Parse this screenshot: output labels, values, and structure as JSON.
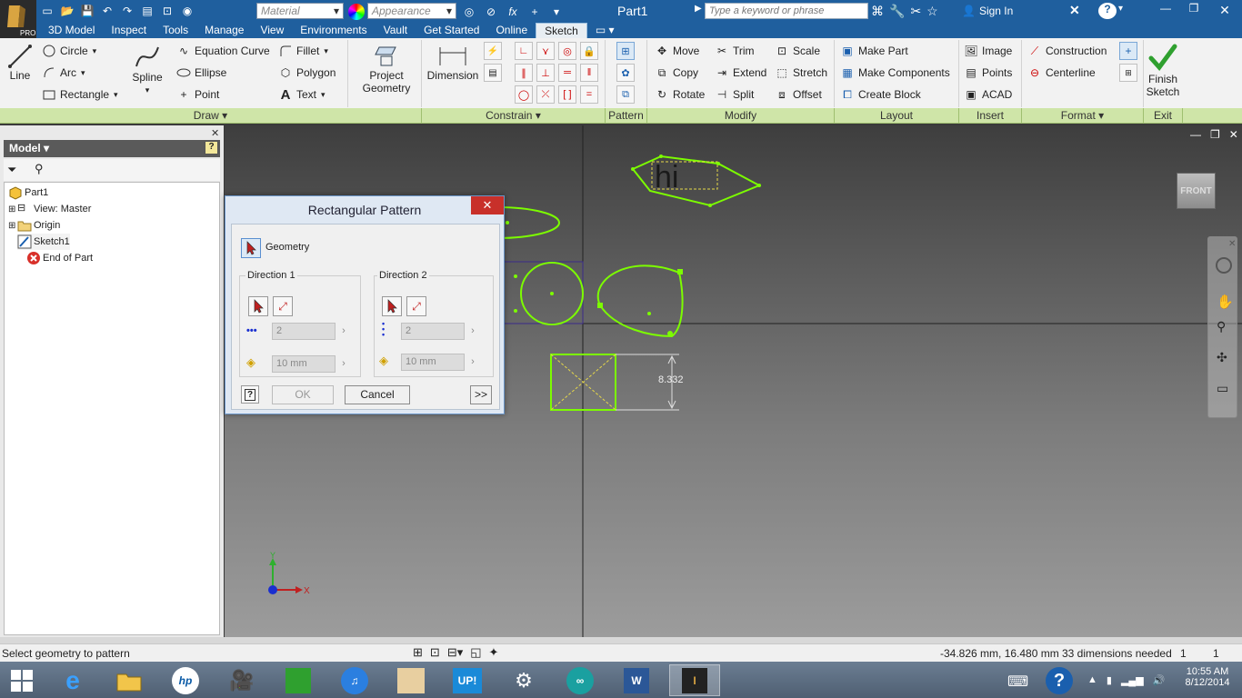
{
  "app": {
    "badge": "PRO",
    "document_title": "Part1",
    "search_placeholder": "Type a keyword or phrase",
    "sign_in": "Sign In"
  },
  "qat": {
    "material": "Material",
    "appearance": "Appearance",
    "fx": "fx"
  },
  "menu_tabs": [
    "3D Model",
    "Inspect",
    "Tools",
    "Manage",
    "View",
    "Environments",
    "Vault",
    "Get Started",
    "Online",
    "Sketch"
  ],
  "ribbon": {
    "draw": {
      "line": "Line",
      "circle": "Circle",
      "arc": "Arc",
      "rectangle": "Rectangle",
      "spline": "Spline",
      "equation_curve": "Equation Curve",
      "ellipse": "Ellipse",
      "point": "Point",
      "fillet": "Fillet",
      "polygon": "Polygon",
      "text": "Text",
      "project_geometry_1": "Project",
      "project_geometry_2": "Geometry"
    },
    "constrain": {
      "dimension": "Dimension"
    },
    "modify": {
      "move": "Move",
      "copy": "Copy",
      "rotate": "Rotate",
      "trim": "Trim",
      "extend": "Extend",
      "split": "Split",
      "scale": "Scale",
      "stretch": "Stretch",
      "offset": "Offset"
    },
    "layout": {
      "make_part": "Make Part",
      "make_components": "Make Components",
      "create_block": "Create Block"
    },
    "insert": {
      "image": "Image",
      "points": "Points",
      "acad": "ACAD"
    },
    "format": {
      "construction": "Construction",
      "centerline": "Centerline"
    },
    "exit": {
      "finish_1": "Finish",
      "finish_2": "Sketch"
    },
    "panels": {
      "draw": "Draw",
      "constrain": "Constrain",
      "pattern": "Pattern",
      "modify": "Modify",
      "layout": "Layout",
      "insert": "Insert",
      "format": "Format",
      "exit": "Exit"
    }
  },
  "browser": {
    "title": "Model",
    "items": [
      {
        "label": "Part1"
      },
      {
        "label": "View: Master"
      },
      {
        "label": "Origin"
      },
      {
        "label": "Sketch1"
      },
      {
        "label": "End of Part"
      }
    ]
  },
  "viewcube": {
    "face": "FRONT"
  },
  "sketch": {
    "text": "hi",
    "dimension": "8.332"
  },
  "axis": {
    "x": "X",
    "y": "Y"
  },
  "dialog": {
    "title": "Rectangular Pattern",
    "geometry_label": "Geometry",
    "direction1": {
      "label": "Direction 1",
      "count": "2",
      "spacing": "10 mm"
    },
    "direction2": {
      "label": "Direction 2",
      "count": "2",
      "spacing": "10 mm"
    },
    "ok": "OK",
    "cancel": "Cancel",
    "more": ">>"
  },
  "status": {
    "prompt": "Select geometry to pattern",
    "coords": "-34.826 mm, 16.480 mm",
    "dims_needed": "33 dimensions needed",
    "val1": "1",
    "val2": "1"
  },
  "taskbar": {
    "time": "10:55 AM",
    "date": "8/12/2014",
    "up_label": "UP!"
  },
  "colors": {
    "titlebar": "#1f5f9e",
    "sketch_green": "#7cfc00",
    "ribbon_footer": "#cfe5a8",
    "close_red": "#c8302a"
  }
}
